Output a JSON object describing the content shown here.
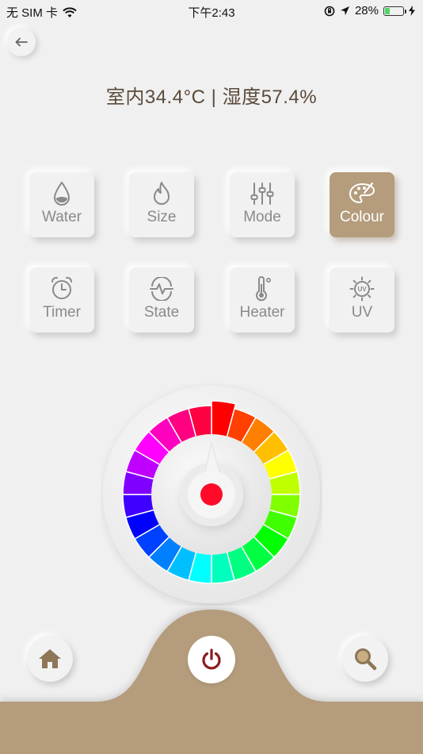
{
  "status_bar": {
    "carrier": "无 SIM 卡",
    "time": "下午2:43",
    "battery": "28%",
    "battery_level": 0.28
  },
  "header": {
    "readout": "室内34.4°C | 湿度57.4%"
  },
  "controls": [
    {
      "label": "Water",
      "icon": "water-drop-icon"
    },
    {
      "label": "Size",
      "icon": "flame-icon"
    },
    {
      "label": "Mode",
      "icon": "sliders-icon"
    },
    {
      "label": "Colour",
      "icon": "palette-icon",
      "active": true
    },
    {
      "label": "Timer",
      "icon": "alarm-clock-icon"
    },
    {
      "label": "State",
      "icon": "pulse-icon"
    },
    {
      "label": "Heater",
      "icon": "thermometer-icon"
    },
    {
      "label": "UV",
      "icon": "uv-icon"
    }
  ],
  "colour_dial": {
    "segments": 24,
    "selected_color": "#ff0b29"
  },
  "bottom_nav": {
    "home_icon": "home-icon",
    "power_icon": "power-icon",
    "search_icon": "search-icon"
  },
  "colors": {
    "accent": "#b49c7c",
    "power": "#8b1c1c",
    "background": "#f0f0f0"
  }
}
